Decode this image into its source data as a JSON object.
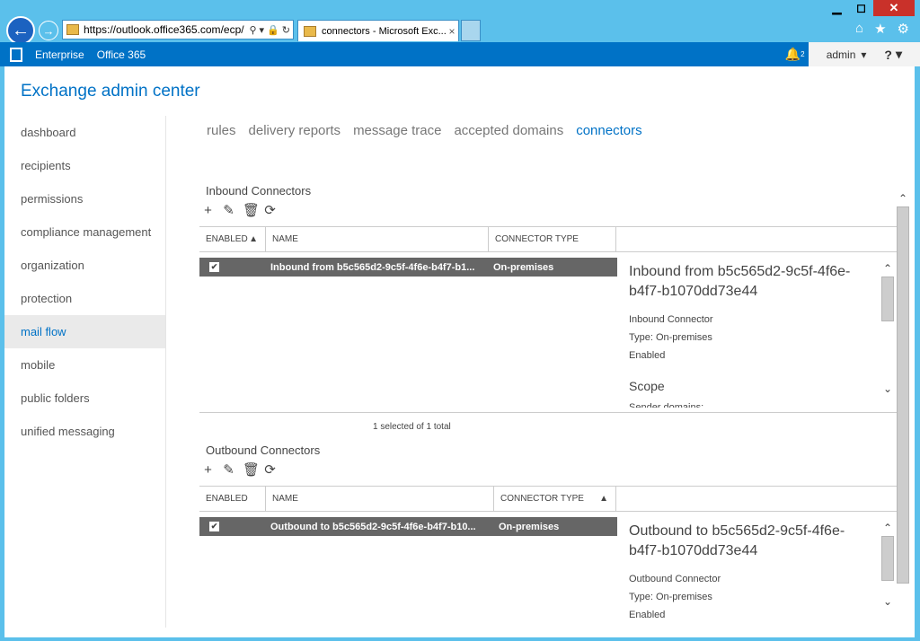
{
  "browser": {
    "url_prefix": "https://",
    "url_host": "outlook.office365.com",
    "url_rest": "/ecp/",
    "tab_title": "connectors - Microsoft Exc...",
    "tab_close": "×",
    "win_minimize": "▁",
    "win_maximize": "◻",
    "win_close": "✕"
  },
  "o365bar": {
    "enterprise": "Enterprise",
    "office365": "Office 365",
    "notification_count": "2",
    "admin": "admin",
    "help": "?"
  },
  "app_title": "Exchange admin center",
  "leftnav": {
    "items": [
      {
        "label": "dashboard"
      },
      {
        "label": "recipients"
      },
      {
        "label": "permissions"
      },
      {
        "label": "compliance management"
      },
      {
        "label": "organization"
      },
      {
        "label": "protection"
      },
      {
        "label": "mail flow"
      },
      {
        "label": "mobile"
      },
      {
        "label": "public folders"
      },
      {
        "label": "unified messaging"
      }
    ],
    "active": "mail flow"
  },
  "subnav": {
    "tabs": [
      {
        "label": "rules"
      },
      {
        "label": "delivery reports"
      },
      {
        "label": "message trace"
      },
      {
        "label": "accepted domains"
      },
      {
        "label": "connectors"
      }
    ],
    "active": "connectors"
  },
  "inbound": {
    "section_title": "Inbound Connectors",
    "columns": {
      "enabled": "ENABLED",
      "name": "NAME",
      "type": "CONNECTOR TYPE"
    },
    "sort_arrow": "▲",
    "row": {
      "name": "Inbound from b5c565d2-9c5f-4f6e-b4f7-b1...",
      "type": "On-premises",
      "checked": "✔"
    },
    "status": "1 selected of 1 total",
    "details": {
      "title": "Inbound from b5c565d2-9c5f-4f6e-b4f7-b1070dd73e44",
      "kind": "Inbound Connector",
      "type": "Type: On-premises",
      "state": "Enabled",
      "scope": "Scope",
      "cut": "Sender domains:"
    }
  },
  "outbound": {
    "section_title": "Outbound Connectors",
    "columns": {
      "enabled": "ENABLED",
      "name": "NAME",
      "type": "CONNECTOR TYPE"
    },
    "sort_arrow": "▲",
    "row": {
      "name": "Outbound to b5c565d2-9c5f-4f6e-b4f7-b10...",
      "type": "On-premises",
      "checked": "✔"
    },
    "details": {
      "title": "Outbound to b5c565d2-9c5f-4f6e-b4f7-b1070dd73e44",
      "kind": "Outbound Connector",
      "type": "Type: On-premises",
      "state": "Enabled"
    }
  },
  "toolbar": {
    "add": "+",
    "edit": "✎",
    "delete": "🗑",
    "refresh": "⟳"
  },
  "scroll": {
    "up": "⌃",
    "down": "⌄"
  }
}
